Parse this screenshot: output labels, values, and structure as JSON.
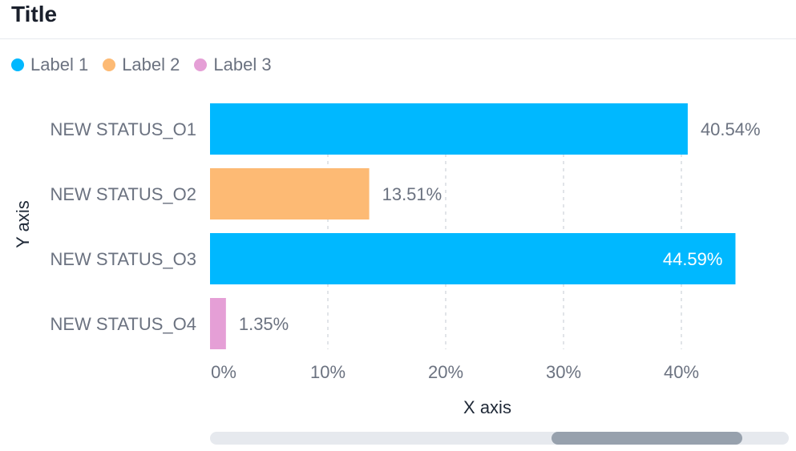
{
  "title": "Title",
  "legend": [
    {
      "label": "Label 1",
      "color": "#00b8ff"
    },
    {
      "label": "Label 2",
      "color": "#fdba74"
    },
    {
      "label": "Label 3",
      "color": "#e59fd6"
    }
  ],
  "chart_data": {
    "type": "bar",
    "orientation": "horizontal",
    "title": "Title",
    "xlabel": "X axis",
    "ylabel": "Y axis",
    "xlim": [
      0,
      45
    ],
    "x_ticks": [
      0,
      10,
      20,
      30,
      40
    ],
    "x_tick_labels": [
      "0%",
      "10%",
      "20%",
      "30%",
      "40%"
    ],
    "grid": "vertical dashed",
    "legend_position": "top-left",
    "categories": [
      "NEW STATUS_O1",
      "NEW STATUS_O2",
      "NEW STATUS_O3",
      "NEW STATUS_O4"
    ],
    "values": [
      40.54,
      13.51,
      44.59,
      1.35
    ],
    "data_labels": [
      "40.54%",
      "13.51%",
      "44.59%",
      "1.35%"
    ],
    "bar_series": [
      "Label 1",
      "Label 2",
      "Label 1",
      "Label 3"
    ],
    "bar_colors": [
      "#00b8ff",
      "#fdba74",
      "#00b8ff",
      "#e59fd6"
    ]
  },
  "scrollbar": {
    "visible_start": 0.59,
    "visible_end": 0.92
  }
}
